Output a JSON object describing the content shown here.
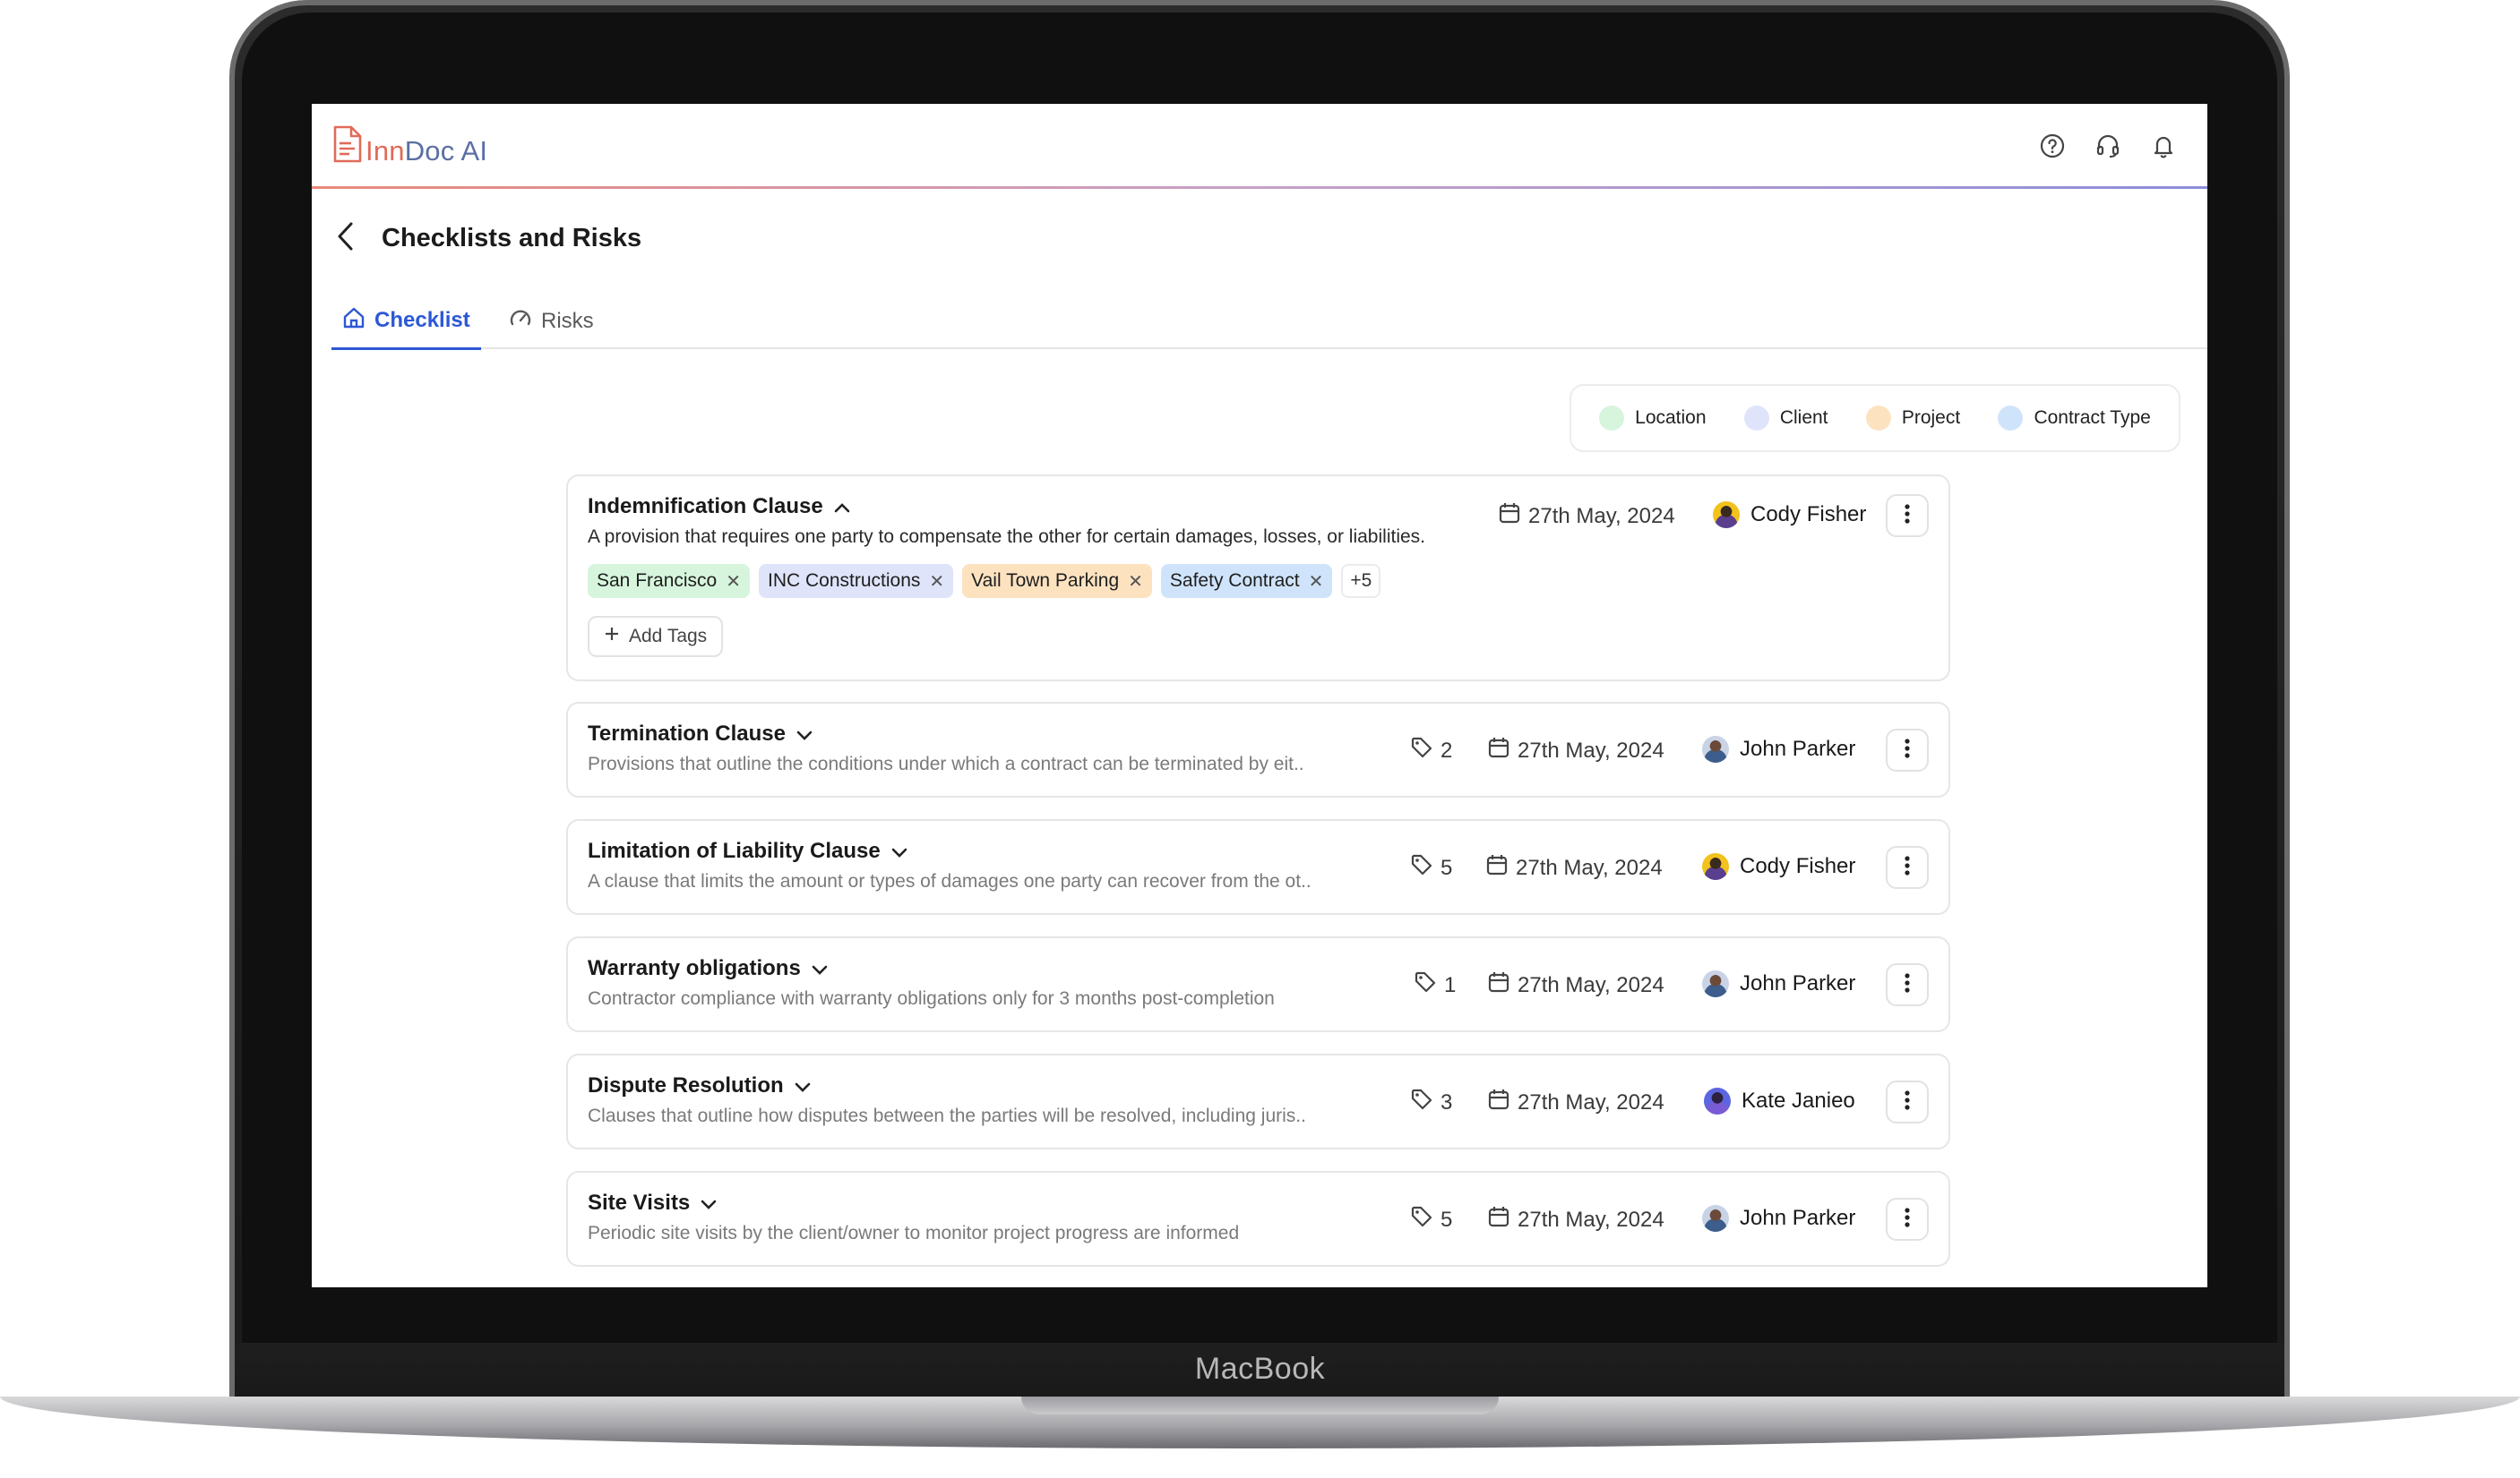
{
  "device": {
    "label": "MacBook"
  },
  "app": {
    "logo_left": "Inn",
    "logo_right": "Doc AI"
  },
  "header": {
    "title": "Checklists and Risks"
  },
  "tabs": [
    {
      "label": "Checklist",
      "icon": "home-icon",
      "active": true
    },
    {
      "label": "Risks",
      "icon": "gauge-icon",
      "active": false
    }
  ],
  "legend": [
    {
      "label": "Location",
      "color": "#d7f5dd"
    },
    {
      "label": "Client",
      "color": "#dfe4fb"
    },
    {
      "label": "Project",
      "color": "#fde2c0"
    },
    {
      "label": "Contract Type",
      "color": "#cfe4fb"
    }
  ],
  "items": [
    {
      "title": "Indemnification Clause",
      "description": "A provision that requires one party to compensate the other for certain damages, losses, or liabilities.",
      "date": "27th May, 2024",
      "owner": "Cody Fisher",
      "expanded": true,
      "tags": [
        {
          "label": "San Francisco",
          "color": "#d7f5dd"
        },
        {
          "label": "INC Constructions",
          "color": "#dfe4fb"
        },
        {
          "label": "Vail Town Parking",
          "color": "#fde2c0"
        },
        {
          "label": "Safety Contract",
          "color": "#cfe4fb"
        }
      ],
      "more_tags": "+5",
      "add_tags_label": "Add Tags"
    },
    {
      "title": "Termination Clause",
      "description": "Provisions that outline the conditions under which a contract can be terminated by eit..",
      "tag_count": "2",
      "date": "27th May, 2024",
      "owner": "John Parker"
    },
    {
      "title": "Limitation of Liability Clause",
      "description": "A clause that limits the amount or types of damages one party can recover from the ot..",
      "tag_count": "5",
      "date": "27th May, 2024",
      "owner": "Cody Fisher"
    },
    {
      "title": "Warranty obligations",
      "description": "Contractor compliance with warranty obligations only for 3 months post-completion",
      "tag_count": "1",
      "date": "27th May, 2024",
      "owner": "John Parker"
    },
    {
      "title": "Dispute Resolution",
      "description": "Clauses that outline how disputes between the parties will be resolved, including juris..",
      "tag_count": "3",
      "date": "27th May, 2024",
      "owner": "Kate Janieo"
    },
    {
      "title": "Site Visits",
      "description": "Periodic site visits by the client/owner to monitor project progress are informed",
      "tag_count": "5",
      "date": "27th May, 2024",
      "owner": "John Parker"
    }
  ]
}
